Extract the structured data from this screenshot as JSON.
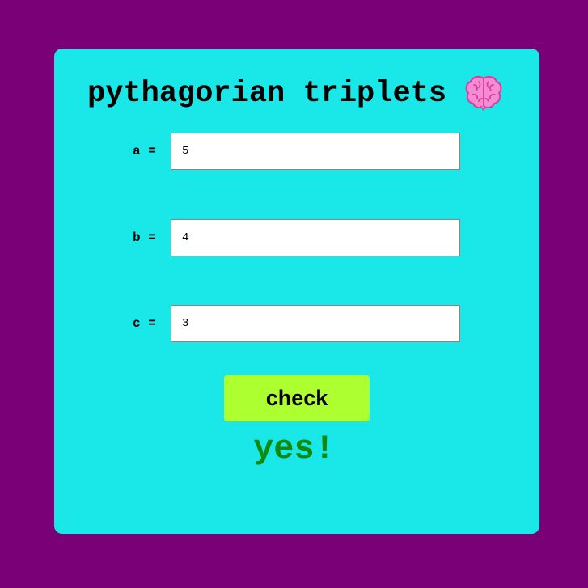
{
  "app": {
    "title": "pythagorian triplets",
    "title_icon": "brain-icon"
  },
  "form": {
    "a_label": "a =",
    "a_value": "5",
    "b_label": "b =",
    "b_value": "4",
    "c_label": "c =",
    "c_value": "3",
    "check_label": "check"
  },
  "result": {
    "text": "yes!",
    "color": "#0f8a0f"
  },
  "colors": {
    "page_background": "#7a0077",
    "card_background": "#1ae8e8",
    "button_background": "#adff2f"
  }
}
